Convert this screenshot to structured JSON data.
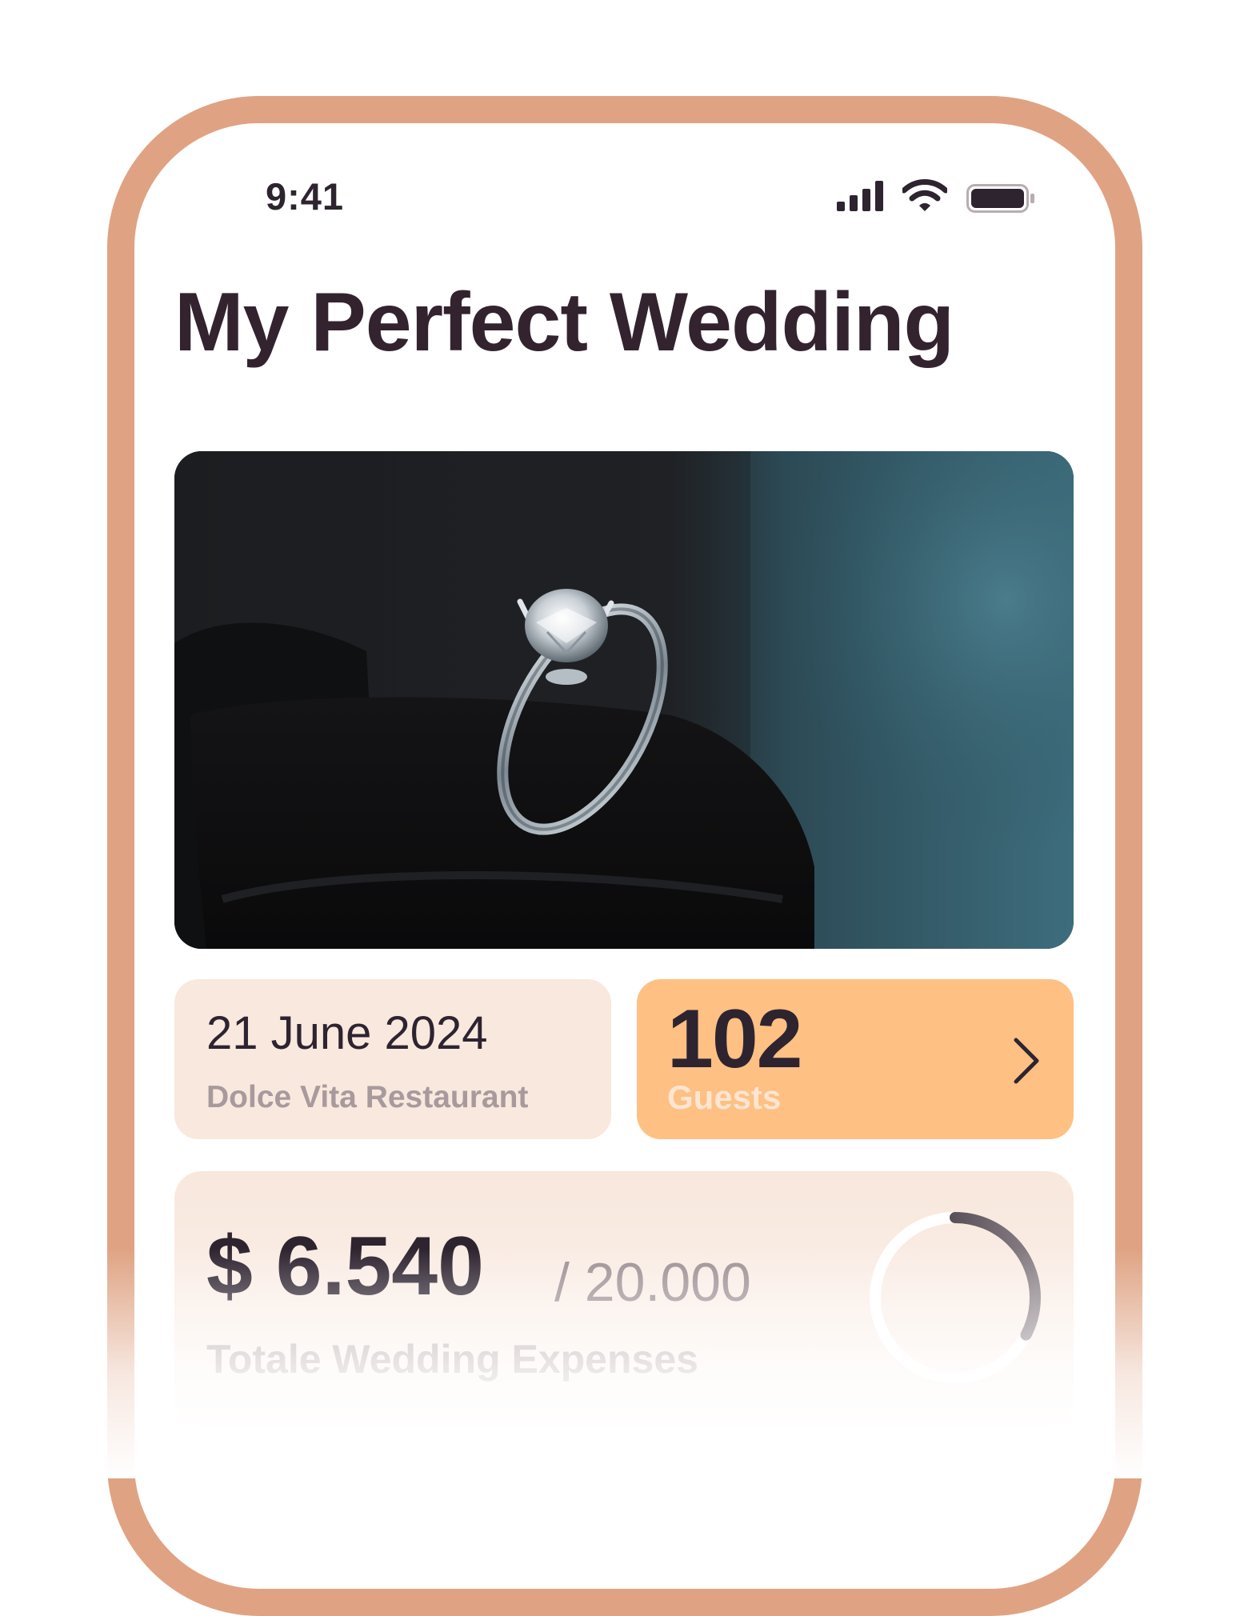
{
  "status_bar": {
    "time": "9:41",
    "icons": [
      "signal-icon",
      "wifi-icon",
      "battery-icon"
    ]
  },
  "header": {
    "title": "My Perfect Wedding"
  },
  "hero_image": {
    "subject": "diamond-engagement-ring-photo"
  },
  "event_card": {
    "date": "21 June 2024",
    "venue": "Dolce Vita Restaurant"
  },
  "guests_card": {
    "count": "102",
    "label": "Guests",
    "icon": "chevron-right-icon"
  },
  "expenses_card": {
    "amount": "$ 6.540",
    "total": "/ 20.000",
    "label": "Totale Wedding Expenses",
    "progress_fraction": 0.327
  },
  "colors": {
    "frame": "#dfa383",
    "text_dark": "#2e2430",
    "card_light": "#f8e8de",
    "card_accent": "#fec083"
  }
}
